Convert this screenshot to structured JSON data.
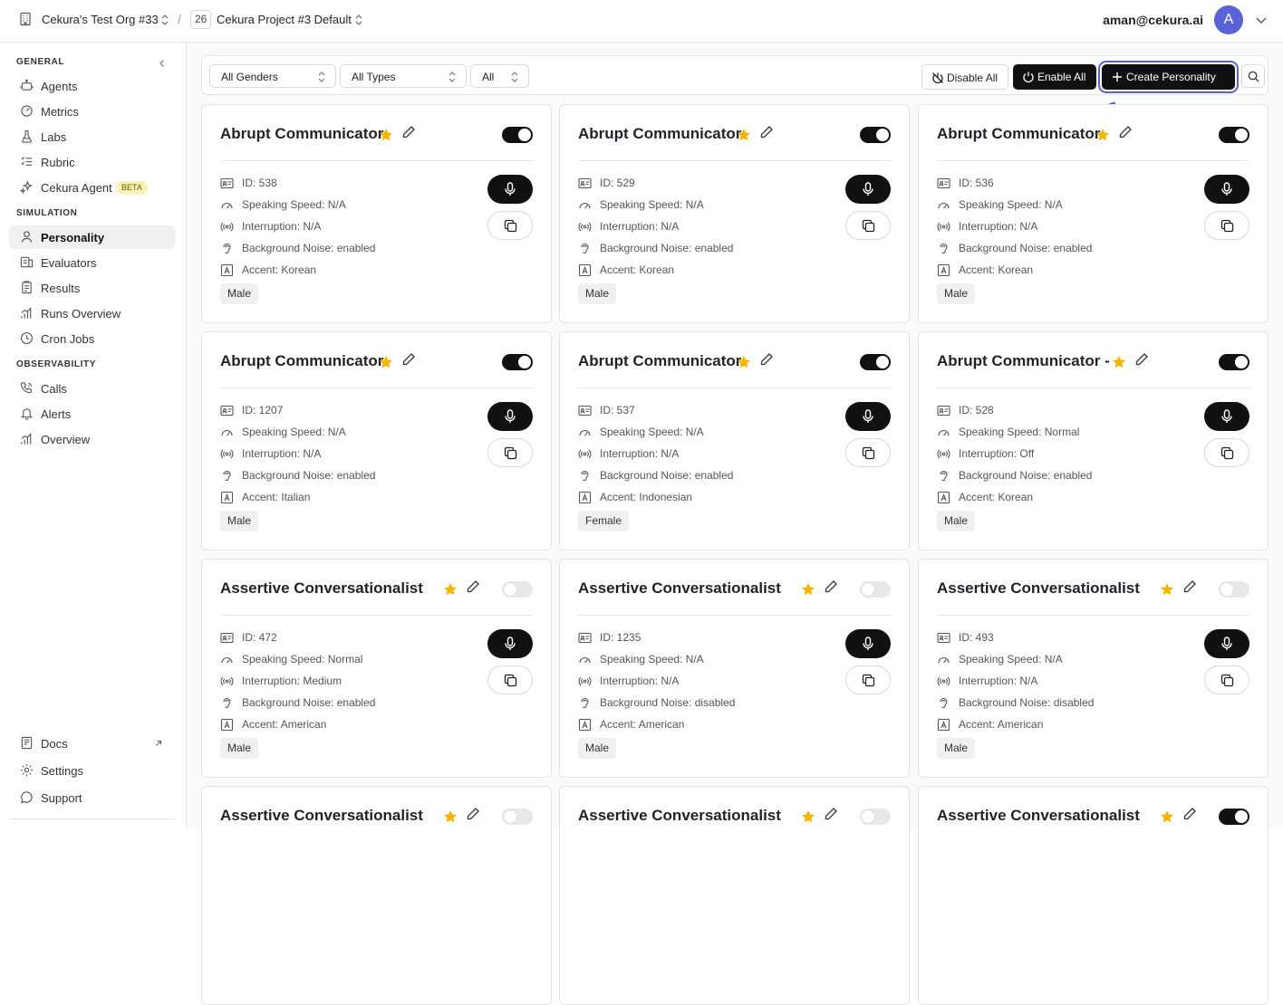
{
  "header": {
    "org_name": "Cekura's Test Org #33",
    "separator": "/",
    "project_id": "26",
    "project_name": "Cekura Project #3 Default",
    "user_email": "aman@cekura.ai",
    "avatar_initial": "A"
  },
  "sidebar": {
    "sections": {
      "general": "GENERAL",
      "simulation": "SIMULATION",
      "observability": "OBSERVABILITY"
    },
    "general_items": [
      {
        "label": "Agents",
        "icon": "robot-icon"
      },
      {
        "label": "Metrics",
        "icon": "gauge-icon"
      },
      {
        "label": "Labs",
        "icon": "flask-icon"
      },
      {
        "label": "Rubric",
        "icon": "list-icon"
      },
      {
        "label": "Cekura Agent",
        "icon": "sparkle-icon",
        "badge": "BETA"
      }
    ],
    "simulation_items": [
      {
        "label": "Personality",
        "icon": "user-icon",
        "active": true
      },
      {
        "label": "Evaluators",
        "icon": "evaluator-icon"
      },
      {
        "label": "Results",
        "icon": "results-icon"
      },
      {
        "label": "Runs Overview",
        "icon": "bar-chart-icon"
      },
      {
        "label": "Cron Jobs",
        "icon": "clock-icon"
      }
    ],
    "observability_items": [
      {
        "label": "Calls",
        "icon": "phone-icon"
      },
      {
        "label": "Alerts",
        "icon": "bell-icon"
      },
      {
        "label": "Overview",
        "icon": "bar-chart-icon"
      }
    ],
    "bottom_items": [
      {
        "label": "Docs",
        "icon": "book-icon"
      },
      {
        "label": "Settings",
        "icon": "gear-icon"
      },
      {
        "label": "Support",
        "icon": "chat-icon"
      }
    ]
  },
  "toolbar": {
    "filters": [
      "All Genders",
      "All Types",
      "All"
    ],
    "disable_all": "Disable All",
    "enable_all": "Enable All",
    "create": "Create Personality"
  },
  "labels": {
    "id": "ID: ",
    "speed": "Speaking Speed: ",
    "interruption": "Interruption: ",
    "noise": "Background Noise: ",
    "accent": "Accent: "
  },
  "colors": {
    "accent": "#5a5fd6",
    "star": "#f5b400",
    "avatar": "#5a62d8"
  },
  "cards": [
    {
      "title": "Abrupt Communicator",
      "enabled": true,
      "id": "538",
      "speed": "N/A",
      "interruption": "N/A",
      "noise": "enabled",
      "accent": "Korean",
      "gender": "Male"
    },
    {
      "title": "Abrupt Communicator",
      "enabled": true,
      "id": "529",
      "speed": "N/A",
      "interruption": "N/A",
      "noise": "enabled",
      "accent": "Korean",
      "gender": "Male"
    },
    {
      "title": "Abrupt Communicator",
      "enabled": true,
      "id": "536",
      "speed": "N/A",
      "interruption": "N/A",
      "noise": "enabled",
      "accent": "Korean",
      "gender": "Male"
    },
    {
      "title": "Abrupt Communicator",
      "enabled": true,
      "id": "1207",
      "speed": "N/A",
      "interruption": "N/A",
      "noise": "enabled",
      "accent": "Italian",
      "gender": "Male"
    },
    {
      "title": "Abrupt Communicator",
      "enabled": true,
      "id": "537",
      "speed": "N/A",
      "interruption": "N/A",
      "noise": "enabled",
      "accent": "Indonesian",
      "gender": "Female"
    },
    {
      "title": "Abrupt Communicator -",
      "enabled": true,
      "id": "528",
      "speed": "Normal",
      "interruption": "Off",
      "noise": "enabled",
      "accent": "Korean",
      "gender": "Male"
    },
    {
      "title": "Assertive Conversationalist",
      "enabled": false,
      "id": "472",
      "speed": "Normal",
      "interruption": "Medium",
      "noise": "enabled",
      "accent": "American",
      "gender": "Male"
    },
    {
      "title": "Assertive Conversationalist",
      "enabled": false,
      "id": "1235",
      "speed": "N/A",
      "interruption": "N/A",
      "noise": "disabled",
      "accent": "American",
      "gender": "Male"
    },
    {
      "title": "Assertive Conversationalist",
      "enabled": false,
      "id": "493",
      "speed": "N/A",
      "interruption": "N/A",
      "noise": "disabled",
      "accent": "American",
      "gender": "Male"
    },
    {
      "title": "Assertive Conversationalist",
      "enabled": false
    },
    {
      "title": "Assertive Conversationalist",
      "enabled": false
    },
    {
      "title": "Assertive Conversationalist",
      "enabled": true
    }
  ]
}
